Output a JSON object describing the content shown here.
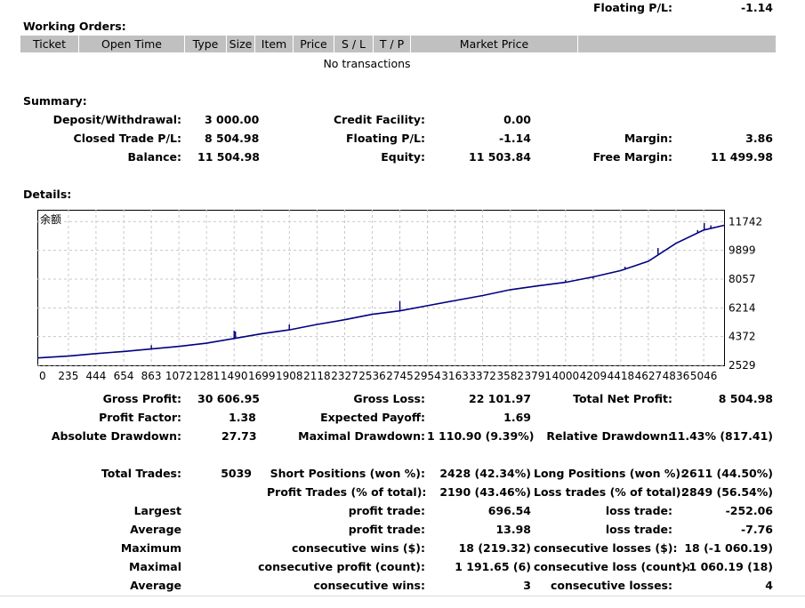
{
  "top": {
    "floating_label": "Floating P/L:",
    "floating_value": "-1.14"
  },
  "working_orders": {
    "title": "Working Orders:",
    "columns": [
      "Ticket",
      "Open Time",
      "Type",
      "Size",
      "Item",
      "Price",
      "S / L",
      "T / P",
      "Market Price",
      ""
    ],
    "empty_text": "No transactions"
  },
  "summary": {
    "title": "Summary:",
    "rows": [
      [
        {
          "label": "Deposit/Withdrawal:",
          "value": "3 000.00"
        },
        {
          "label": "Credit Facility:",
          "value": "0.00"
        },
        {
          "label": "",
          "value": ""
        }
      ],
      [
        {
          "label": "Closed Trade P/L:",
          "value": "8 504.98"
        },
        {
          "label": "Floating P/L:",
          "value": "-1.14"
        },
        {
          "label": "Margin:",
          "value": "3.86"
        }
      ],
      [
        {
          "label": "Balance:",
          "value": "11 504.98"
        },
        {
          "label": "Equity:",
          "value": "11 503.84"
        },
        {
          "label": "Free Margin:",
          "value": "11 499.98"
        }
      ]
    ]
  },
  "details": {
    "title": "Details:"
  },
  "chart_data": {
    "type": "line",
    "title": "余额",
    "x": [
      0,
      235,
      444,
      654,
      863,
      1072,
      1281,
      1490,
      1699,
      1908,
      2118,
      2327,
      2536,
      2745,
      2954,
      3163,
      3372,
      3582,
      3791,
      4000,
      4209,
      4418,
      4627,
      4836,
      5046,
      5200
    ],
    "series": [
      {
        "values": [
          3000,
          3120,
          3280,
          3420,
          3580,
          3740,
          3950,
          4250,
          4560,
          4800,
          5150,
          5450,
          5800,
          6020,
          6350,
          6680,
          7000,
          7380,
          7620,
          7850,
          8200,
          8600,
          9200,
          10350,
          11200,
          11503
        ]
      }
    ],
    "spikes": [
      {
        "x": 863,
        "y": 3820
      },
      {
        "x": 1490,
        "y": 4750
      },
      {
        "x": 1500,
        "y": 4700
      },
      {
        "x": 1908,
        "y": 5150
      },
      {
        "x": 2745,
        "y": 6650
      },
      {
        "x": 2840,
        "y": 6200
      },
      {
        "x": 4000,
        "y": 8000
      },
      {
        "x": 4209,
        "y": 8080
      },
      {
        "x": 4450,
        "y": 8850
      },
      {
        "x": 4700,
        "y": 10050
      },
      {
        "x": 5000,
        "y": 11200
      },
      {
        "x": 5050,
        "y": 11650
      },
      {
        "x": 5100,
        "y": 11500
      }
    ],
    "yticks": [
      "11742",
      "9899",
      "8057",
      "6214",
      "4372",
      "2529"
    ],
    "ytick_values": [
      11742,
      9899,
      8057,
      6214,
      4372,
      2529
    ],
    "xticks": [
      "0",
      "235",
      "444",
      "654",
      "863",
      "1072",
      "1281",
      "1490",
      "1699",
      "1908",
      "2118",
      "2327",
      "2536",
      "2745",
      "2954",
      "3163",
      "3372",
      "3582",
      "3791",
      "4000",
      "4209",
      "4418",
      "4627",
      "4836",
      "5046"
    ],
    "ylim": [
      2529,
      12500
    ],
    "xlim": [
      0,
      5200
    ],
    "grid": true,
    "line_color": "#00007f",
    "grid_color": "#c8c8c8"
  },
  "stats": {
    "gross_profit_label": "Gross Profit:",
    "gross_profit": "30 606.95",
    "gross_loss_label": "Gross Loss:",
    "gross_loss": "22 101.97",
    "total_net_profit_label": "Total Net Profit:",
    "total_net_profit": "8 504.98",
    "profit_factor_label": "Profit Factor:",
    "profit_factor": "1.38",
    "expected_payoff_label": "Expected Payoff:",
    "expected_payoff": "1.69",
    "absolute_drawdown_label": "Absolute Drawdown:",
    "absolute_drawdown": "27.73",
    "maximal_drawdown_label": "Maximal Drawdown:",
    "maximal_drawdown": "1 110.90 (9.39%)",
    "relative_drawdown_label": "Relative Drawdown:",
    "relative_drawdown": "11.43% (817.41)",
    "total_trades_label": "Total Trades:",
    "total_trades": "5039",
    "short_positions_label": "Short Positions (won %):",
    "short_positions": "2428 (42.34%)",
    "long_positions_label": "Long Positions (won %):",
    "long_positions": "2611 (44.50%)",
    "profit_trades_label": "Profit Trades (% of total):",
    "profit_trades": "2190 (43.46%)",
    "loss_trades_label": "Loss trades (% of total):",
    "loss_trades": "2849 (56.54%)",
    "largest_label": "Largest",
    "largest_profit_label": "profit trade:",
    "largest_profit": "696.54",
    "largest_loss_label": "loss trade:",
    "largest_loss": "-252.06",
    "average_label": "Average",
    "average_profit_label": "profit trade:",
    "average_profit": "13.98",
    "average_loss_label": "loss trade:",
    "average_loss": "-7.76",
    "maximum_label": "Maximum",
    "max_wins_label": "consecutive wins ($):",
    "max_wins": "18 (219.32)",
    "max_losses_label": "consecutive losses ($):",
    "max_losses": "18 (-1 060.19)",
    "maximal_label": "Maximal",
    "maximal_profit_label": "consecutive profit (count):",
    "maximal_profit": "1 191.65 (6)",
    "maximal_loss_label": "consecutive loss (count):",
    "maximal_loss": "-1 060.19 (18)",
    "average2_label": "Average",
    "avg_wins_label": "consecutive wins:",
    "avg_wins": "3",
    "avg_losses_label": "consecutive losses:",
    "avg_losses": "4"
  }
}
